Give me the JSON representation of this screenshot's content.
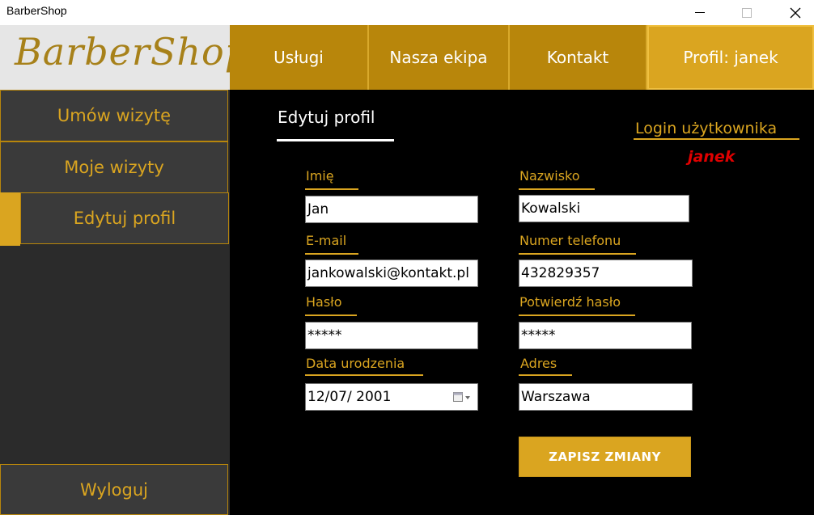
{
  "window": {
    "title": "BarberShop"
  },
  "logo": {
    "text": "BarberShop"
  },
  "nav": {
    "items": [
      "Usługi",
      "Nasza ekipa",
      "Kontakt"
    ],
    "profile": "Profil: janek"
  },
  "sidebar": {
    "items": [
      "Umów wizytę",
      "Moje wizyty",
      "Edytuj profil"
    ],
    "logout": "Wyloguj",
    "active_index": 2
  },
  "main": {
    "title": "Edytuj profil",
    "login_label": "Login użytkownika",
    "login_value": "janek"
  },
  "form": {
    "first_name": {
      "label": "Imię",
      "value": "Jan"
    },
    "last_name": {
      "label": "Nazwisko",
      "value": "Kowalski"
    },
    "email": {
      "label": "E-mail",
      "value": "jankowalski@kontakt.pl"
    },
    "phone": {
      "label": "Numer telefonu",
      "value": "432829357"
    },
    "password": {
      "label": "Hasło",
      "value": "*****"
    },
    "confirm_password": {
      "label": "Potwierdź hasło",
      "value": "*****"
    },
    "birth_date": {
      "label": "Data urodzenia",
      "value": "12/07/ 2001"
    },
    "address": {
      "label": "Adres",
      "value": "Warszawa"
    },
    "save_label": "ZAPISZ ZMIANY"
  },
  "colors": {
    "accent": "#daa520",
    "nav": "#b8860b",
    "error": "#e00000",
    "sidebar": "#2b2b2b"
  },
  "icons": [
    "minimize-icon",
    "maximize-icon",
    "close-icon",
    "calendar-icon"
  ]
}
